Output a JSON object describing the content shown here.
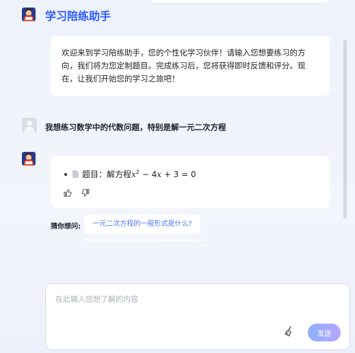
{
  "header": {
    "title": "学习陪练助手"
  },
  "welcome": {
    "text": "欢迎来到学习陪练助手，您的个性化学习伙伴！请输入您想要练习的方向，我们将为您定制题目。完成练习后，您将获得即时反馈和评分。现在，让我们开始您的学习之旅吧！"
  },
  "user_message": {
    "text": "我想练习数学中的代数问题，特别是解一元二次方程"
  },
  "answer": {
    "prefix": "题目：解方程",
    "var": "x",
    "exp": "2",
    "mid": " − 4",
    "var2": "x",
    "suffix": " + 3 = 0",
    "icons": [
      "thumbs-up-icon",
      "thumbs-down-icon"
    ]
  },
  "suggestions": {
    "label": "猜你想问:",
    "items": [
      "一元二次方程的一般形式是什么?"
    ]
  },
  "input": {
    "placeholder": "在此输入您想了解的内容",
    "send_label": "发送"
  }
}
